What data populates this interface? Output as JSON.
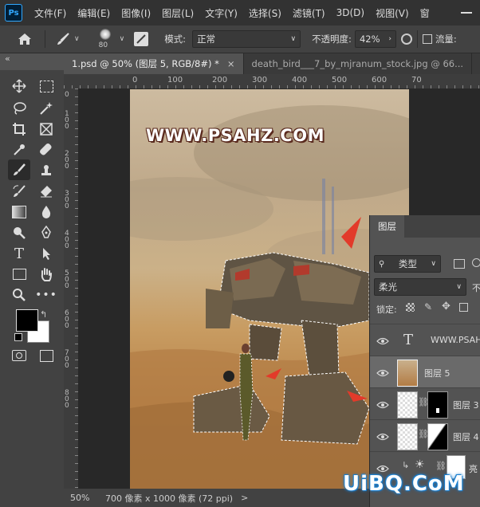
{
  "app": {
    "logo": "Ps"
  },
  "menu": [
    "文件(F)",
    "编辑(E)",
    "图像(I)",
    "图层(L)",
    "文字(Y)",
    "选择(S)",
    "滤镜(T)",
    "3D(D)",
    "视图(V)",
    "窗"
  ],
  "options": {
    "brush_size": "80",
    "mode_label": "模式:",
    "mode_value": "正常",
    "opacity_label": "不透明度:",
    "opacity_value": "42%",
    "flow_label": "流量:"
  },
  "tabs": [
    {
      "label": "1.psd @ 50% (图层 5, RGB/8#) *",
      "close": "×"
    },
    {
      "label": "death_bird___7_by_mjranum_stock.jpg @ 66..."
    }
  ],
  "collapse_label": "«",
  "ruler": {
    "top": [
      "0",
      "100",
      "200",
      "300",
      "400",
      "500",
      "600",
      "70"
    ],
    "left": [
      "0",
      "1 0 0",
      "2 0 0",
      "3 0 0",
      "4 0 0",
      "5 0 0",
      "6 0 0",
      "7 0 0",
      "8 0 0"
    ]
  },
  "canvas": {
    "watermark": "WWW.PSAHZ.COM"
  },
  "status": {
    "zoom": "50%",
    "info": "700 像素 x 1000 像素 (72 ppi)",
    "arrow": ">"
  },
  "layers_panel": {
    "title": "图层",
    "filter": "类型",
    "blend": "柔光",
    "blend_opacity": "不",
    "lock_label": "锁定:",
    "layers": [
      {
        "name": "WWW.PSAHZ",
        "type": "text",
        "thumb": "T"
      },
      {
        "name": "图层 5",
        "type": "pixel"
      },
      {
        "name": "图层 3",
        "type": "masked"
      },
      {
        "name": "图层 4",
        "type": "masked"
      },
      {
        "name": "亮",
        "type": "adjustment"
      }
    ]
  },
  "site_watermark": "UiBQ.CoM",
  "colors": {
    "accent": "#31a8ff",
    "ui_dark": "#323232",
    "ui_mid": "#424242",
    "ui_base": "#535353"
  }
}
